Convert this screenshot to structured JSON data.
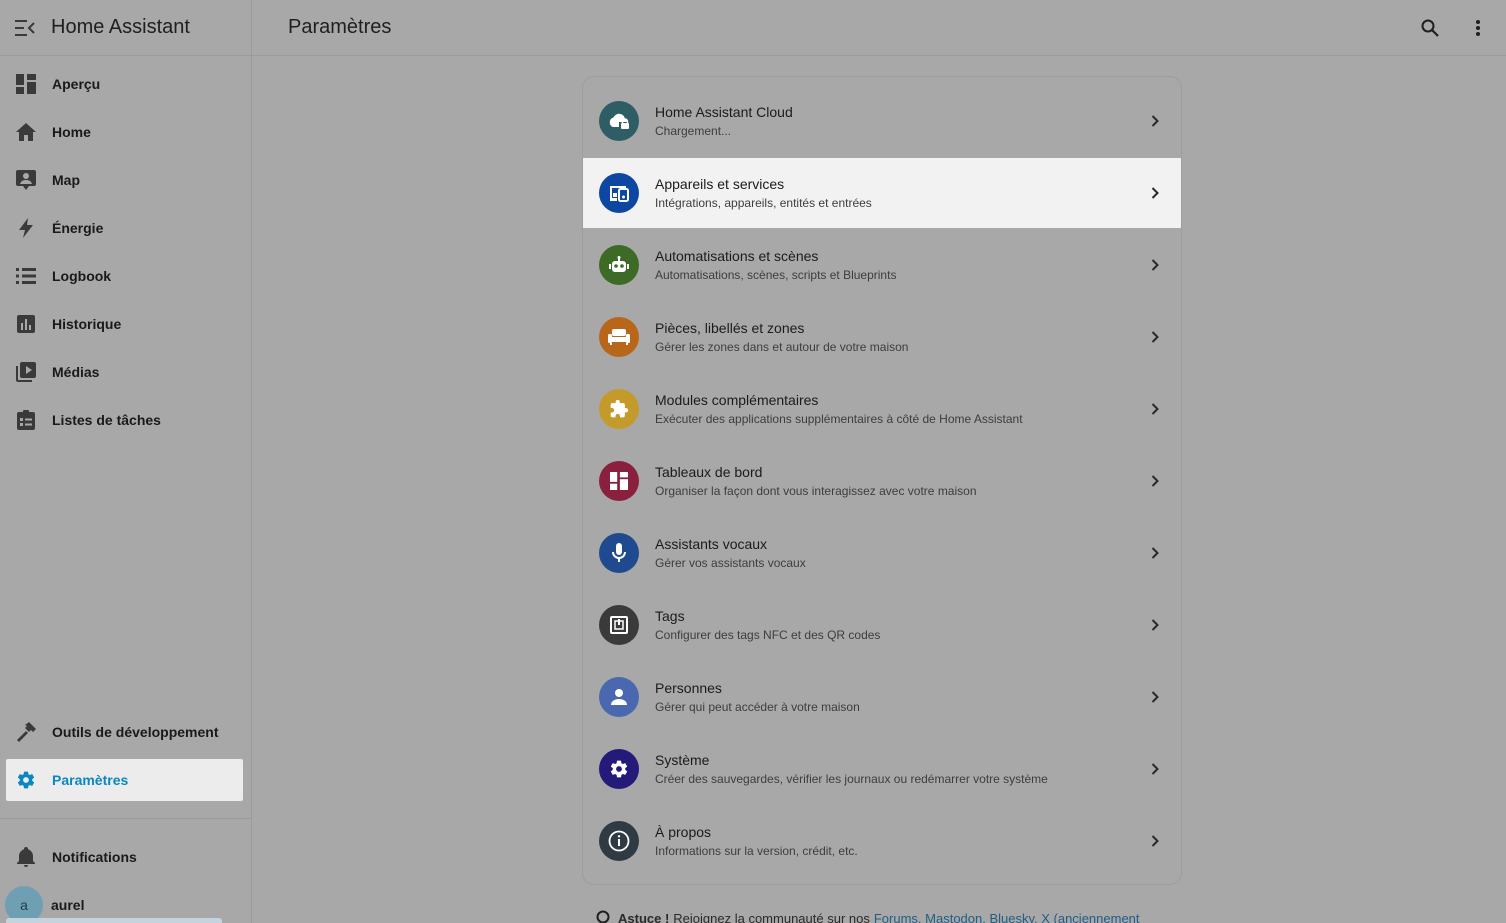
{
  "app": {
    "title": "Home Assistant"
  },
  "header": {
    "title": "Paramètres"
  },
  "sidebar": {
    "items": [
      {
        "label": "Aperçu",
        "icon": "dashboard-icon"
      },
      {
        "label": "Home",
        "icon": "home-icon"
      },
      {
        "label": "Map",
        "icon": "map-icon"
      },
      {
        "label": "Énergie",
        "icon": "lightning-icon"
      },
      {
        "label": "Logbook",
        "icon": "list-icon"
      },
      {
        "label": "Historique",
        "icon": "chart-icon"
      },
      {
        "label": "Médias",
        "icon": "media-icon"
      },
      {
        "label": "Listes de tâches",
        "icon": "clipboard-icon"
      }
    ],
    "bottom": [
      {
        "label": "Outils de développement",
        "icon": "hammer-icon"
      },
      {
        "label": "Paramètres",
        "icon": "gear-icon",
        "active": true
      }
    ],
    "notifications_label": "Notifications",
    "user": {
      "initial": "a",
      "name": "aurel"
    }
  },
  "settings": {
    "rows": [
      {
        "title": "Home Assistant Cloud",
        "subtitle": "Chargement...",
        "color": "#2e5d66"
      },
      {
        "title": "Appareils et services",
        "subtitle": "Intégrations, appareils, entités et entrées",
        "color": "#0d47a1"
      },
      {
        "title": "Automatisations et scènes",
        "subtitle": "Automatisations, scènes, scripts et Blueprints",
        "color": "#3d6b25"
      },
      {
        "title": "Pièces, libellés et zones",
        "subtitle": "Gérer les zones dans et autour de votre maison",
        "color": "#b8661a"
      },
      {
        "title": "Modules complémentaires",
        "subtitle": "Exécuter des applications supplémentaires à côté de Home Assistant",
        "color": "#c49a2a"
      },
      {
        "title": "Tableaux de bord",
        "subtitle": "Organiser la façon dont vous interagissez avec votre maison",
        "color": "#8a1f3e"
      },
      {
        "title": "Assistants vocaux",
        "subtitle": "Gérer vos assistants vocaux",
        "color": "#1f4a8f"
      },
      {
        "title": "Tags",
        "subtitle": "Configurer des tags NFC et des QR codes",
        "color": "#3a3a3a"
      },
      {
        "title": "Personnes",
        "subtitle": "Gérer qui peut accéder à votre maison",
        "color": "#4a68b0"
      },
      {
        "title": "Système",
        "subtitle": "Créer des sauvegardes, vérifier les journaux ou redémarrer votre système",
        "color": "#231a7a"
      },
      {
        "title": "À propos",
        "subtitle": "Informations sur la version, crédit, etc.",
        "color": "#303a42"
      }
    ]
  },
  "tip": {
    "strong": "Astuce !",
    "text": "Rejoignez la communauté sur nos",
    "links": "Forums, Mastodon, Bluesky, X (anciennement"
  },
  "colors": {
    "active": "#0a87c0",
    "highlight": "#f2f2f2",
    "background": "#a8a8a8"
  }
}
